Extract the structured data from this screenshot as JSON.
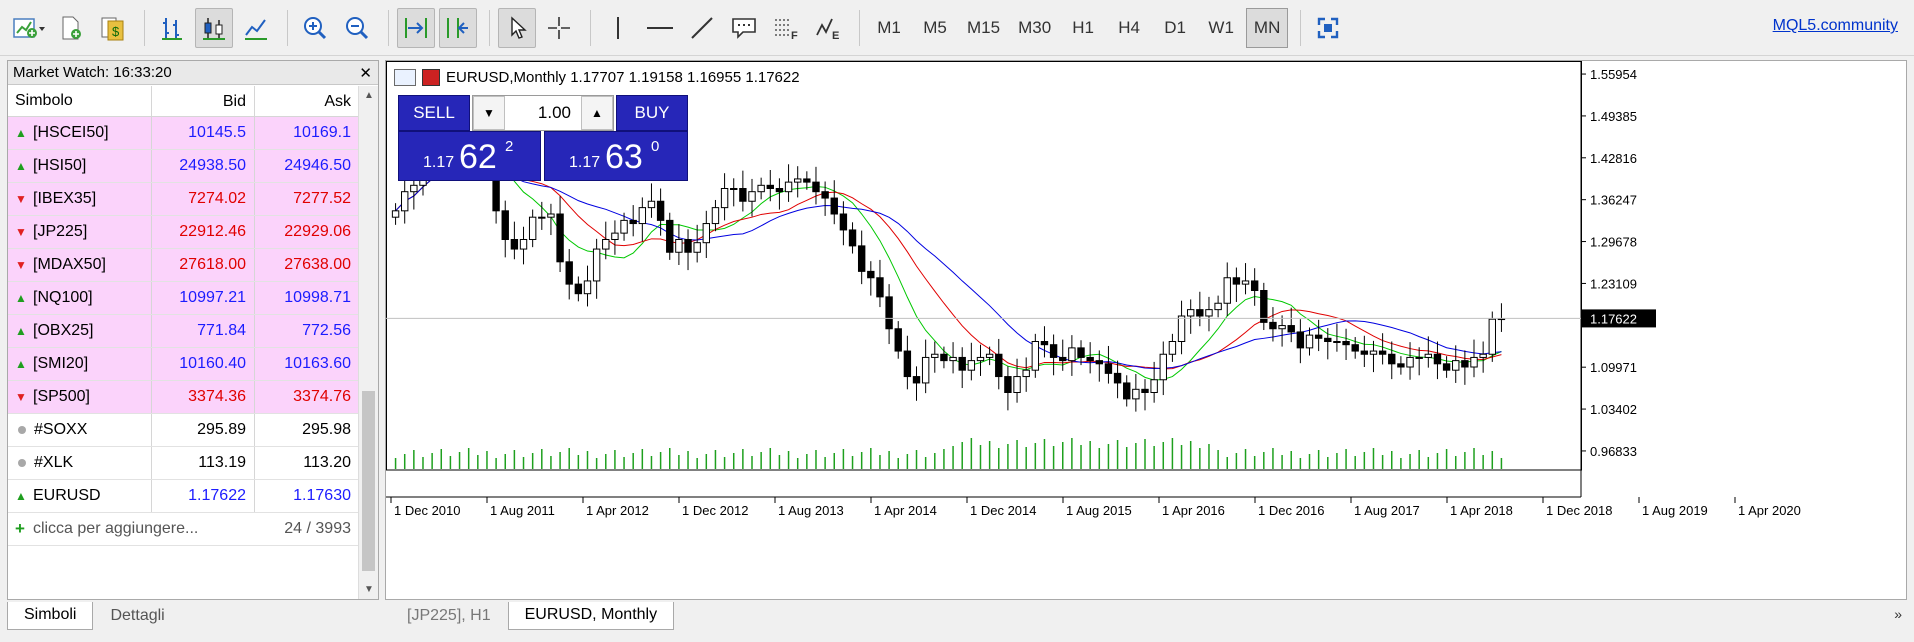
{
  "toolbar": {
    "timeframes": [
      "M1",
      "M5",
      "M15",
      "M30",
      "H1",
      "H4",
      "D1",
      "W1",
      "MN"
    ],
    "active_timeframe": "MN",
    "link": "MQL5.community"
  },
  "market_watch": {
    "title": "Market Watch: 16:33:20",
    "columns": {
      "symbol": "Simbolo",
      "bid": "Bid",
      "ask": "Ask"
    },
    "rows": [
      {
        "symbol": "[HSCEI50]",
        "bid": "10145.5",
        "ask": "10169.1",
        "dir": "up",
        "highlight": true
      },
      {
        "symbol": "[HSI50]",
        "bid": "24938.50",
        "ask": "24946.50",
        "dir": "up",
        "highlight": true
      },
      {
        "symbol": "[IBEX35]",
        "bid": "7274.02",
        "ask": "7277.52",
        "dir": "down",
        "highlight": true
      },
      {
        "symbol": "[JP225]",
        "bid": "22912.46",
        "ask": "22929.06",
        "dir": "down",
        "highlight": true
      },
      {
        "symbol": "[MDAX50]",
        "bid": "27618.00",
        "ask": "27638.00",
        "dir": "down",
        "highlight": true
      },
      {
        "symbol": "[NQ100]",
        "bid": "10997.21",
        "ask": "10998.71",
        "dir": "up",
        "highlight": true
      },
      {
        "symbol": "[OBX25]",
        "bid": "771.84",
        "ask": "772.56",
        "dir": "up",
        "highlight": true
      },
      {
        "symbol": "[SMI20]",
        "bid": "10160.40",
        "ask": "10163.60",
        "dir": "up",
        "highlight": true
      },
      {
        "symbol": "[SP500]",
        "bid": "3374.36",
        "ask": "3374.76",
        "dir": "down",
        "highlight": true
      },
      {
        "symbol": "#SOXX",
        "bid": "295.89",
        "ask": "295.98",
        "dir": "none",
        "highlight": false
      },
      {
        "symbol": "#XLK",
        "bid": "113.19",
        "ask": "113.20",
        "dir": "none",
        "highlight": false
      },
      {
        "symbol": "EURUSD",
        "bid": "1.17622",
        "ask": "1.17630",
        "dir": "up",
        "highlight": false
      }
    ],
    "add_label": "clicca per aggiungere...",
    "count": "24 / 3993",
    "tabs": [
      "Simboli",
      "Dettagli"
    ],
    "active_tab": "Simboli"
  },
  "chart": {
    "header": "EURUSD,Monthly  1.17707 1.19158 1.16955 1.17622",
    "sell_label": "SELL",
    "buy_label": "BUY",
    "lot": "1.00",
    "sell_price": {
      "prefix": "1.17",
      "big": "62",
      "sup": "2"
    },
    "buy_price": {
      "prefix": "1.17",
      "big": "63",
      "sup": "0"
    },
    "price_axis": [
      "1.55954",
      "1.49385",
      "1.42816",
      "1.36247",
      "1.29678",
      "1.23109",
      "1.09971",
      "1.03402",
      "0.96833"
    ],
    "current_price": "1.17622",
    "time_axis": [
      "1 Dec 2010",
      "1 Aug 2011",
      "1 Apr 2012",
      "1 Dec 2012",
      "1 Aug 2013",
      "1 Apr 2014",
      "1 Dec 2014",
      "1 Aug 2015",
      "1 Apr 2016",
      "1 Dec 2016",
      "1 Aug 2017",
      "1 Apr 2018",
      "1 Dec 2018",
      "1 Aug 2019",
      "1 Apr 2020"
    ],
    "tabs": [
      "[JP225], H1",
      "EURUSD, Monthly"
    ],
    "active_tab": "EURUSD, Monthly",
    "colors": {
      "ma_green": "#00c800",
      "ma_red": "#e00000",
      "ma_blue": "#0000e0",
      "volume": "#1ea01e",
      "panel": "#2626b8"
    }
  },
  "chart_data": {
    "type": "candlestick",
    "symbol": "EURUSD",
    "timeframe": "Monthly",
    "last": {
      "open": 1.17707,
      "high": 1.19158,
      "low": 1.16955,
      "close": 1.17622
    },
    "closes": [
      1.345,
      1.375,
      1.385,
      1.425,
      1.445,
      1.455,
      1.435,
      1.42,
      1.44,
      1.46,
      1.445,
      1.345,
      1.3,
      1.285,
      1.3,
      1.335,
      1.335,
      1.34,
      1.265,
      1.23,
      1.215,
      1.235,
      1.285,
      1.3,
      1.31,
      1.33,
      1.325,
      1.35,
      1.36,
      1.33,
      1.28,
      1.3,
      1.28,
      1.295,
      1.325,
      1.35,
      1.38,
      1.38,
      1.36,
      1.375,
      1.385,
      1.38,
      1.375,
      1.39,
      1.395,
      1.39,
      1.375,
      1.365,
      1.34,
      1.315,
      1.29,
      1.25,
      1.24,
      1.21,
      1.16,
      1.125,
      1.085,
      1.075,
      1.115,
      1.12,
      1.11,
      1.115,
      1.095,
      1.11,
      1.115,
      1.12,
      1.085,
      1.06,
      1.085,
      1.095,
      1.14,
      1.135,
      1.115,
      1.11,
      1.13,
      1.115,
      1.11,
      1.105,
      1.09,
      1.075,
      1.05,
      1.065,
      1.06,
      1.08,
      1.12,
      1.14,
      1.18,
      1.19,
      1.18,
      1.19,
      1.2,
      1.24,
      1.23,
      1.235,
      1.22,
      1.17,
      1.16,
      1.165,
      1.155,
      1.13,
      1.15,
      1.145,
      1.14,
      1.14,
      1.135,
      1.125,
      1.12,
      1.125,
      1.12,
      1.105,
      1.1,
      1.115,
      1.115,
      1.12,
      1.105,
      1.095,
      1.11,
      1.1,
      1.115,
      1.12,
      1.175,
      1.176
    ],
    "ylim": [
      0.94,
      1.58
    ]
  }
}
